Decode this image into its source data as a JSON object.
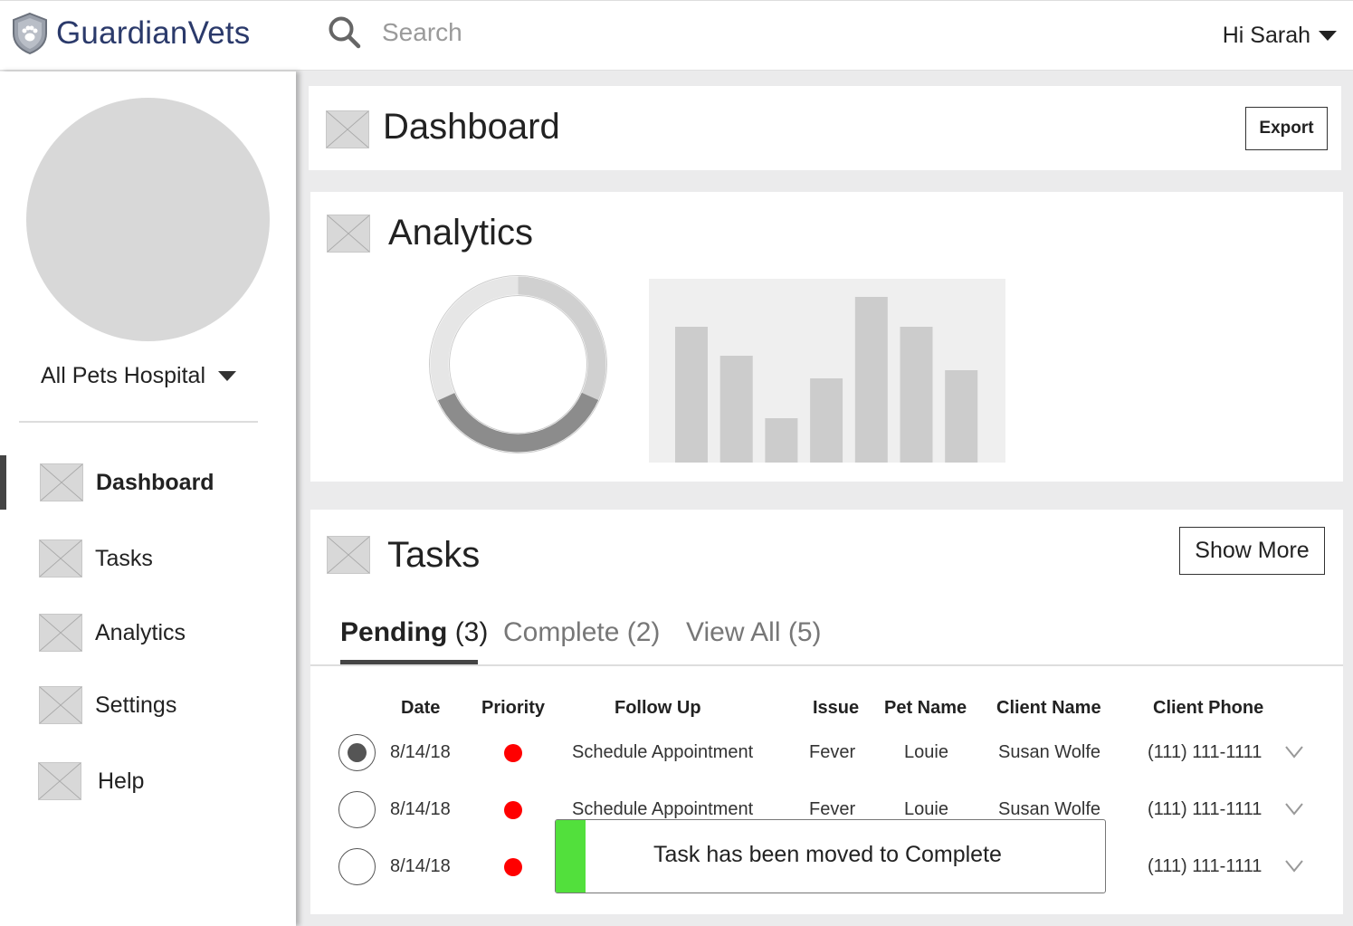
{
  "app": {
    "logo_text": "GuardianVets"
  },
  "header": {
    "search_placeholder": "Search",
    "user_greeting": "Hi Sarah"
  },
  "sidebar": {
    "hospital_name": "All Pets Hospital",
    "items": [
      {
        "label": "Dashboard",
        "active": true
      },
      {
        "label": "Tasks",
        "active": false
      },
      {
        "label": "Analytics",
        "active": false
      },
      {
        "label": "Settings",
        "active": false
      },
      {
        "label": "Help",
        "active": false
      }
    ]
  },
  "dashboard": {
    "title": "Dashboard",
    "export_label": "Export"
  },
  "analytics": {
    "title": "Analytics",
    "donut": {
      "filled_dark_fraction": 0.36,
      "filled_light_fraction": 0.32
    },
    "bars": [
      0.74,
      0.58,
      0.24,
      0.46,
      0.9,
      0.74,
      0.5
    ]
  },
  "tasks": {
    "title": "Tasks",
    "show_more_label": "Show More",
    "tabs": [
      {
        "name": "Pending",
        "count": "(3)",
        "active": true
      },
      {
        "name": "Complete",
        "count": "(2)",
        "active": false
      },
      {
        "name": "View All",
        "count": "(5)",
        "active": false
      }
    ],
    "columns": [
      "Date",
      "Priority",
      "Follow Up",
      "Issue",
      "Pet Name",
      "Client Name",
      "Client Phone"
    ],
    "rows": [
      {
        "selected": true,
        "date": "8/14/18",
        "priority": "high",
        "follow_up": "Schedule Appointment",
        "issue": "Fever",
        "pet_name": "Louie",
        "client_name": "Susan Wolfe",
        "client_phone": "(111) 111-1111"
      },
      {
        "selected": false,
        "date": "8/14/18",
        "priority": "high",
        "follow_up": "Schedule Appointment",
        "issue": "Fever",
        "pet_name": "Louie",
        "client_name": "Susan Wolfe",
        "client_phone": "(111) 111-1111"
      },
      {
        "selected": false,
        "date": "8/14/18",
        "priority": "high",
        "follow_up": "",
        "issue": "",
        "pet_name": "",
        "client_name": "",
        "client_phone": "(111) 111-1111"
      }
    ],
    "toast_message": "Task has been moved to Complete"
  },
  "colors": {
    "priority_high": "#ff0000",
    "toast_accent": "#52e03c",
    "brand": "#2b3a6b"
  }
}
